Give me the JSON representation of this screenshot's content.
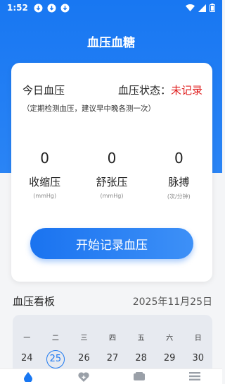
{
  "status_bar": {
    "time": "1:52"
  },
  "header": {
    "title": "血压血糖"
  },
  "card": {
    "today_label": "今日血压",
    "status_label": "血压状态：",
    "status_value": "未记录",
    "note": "（定期检测血压，建议早中晚各测一次）",
    "metrics": [
      {
        "value": "0",
        "label": "收缩压",
        "unit": "(mmHg)"
      },
      {
        "value": "0",
        "label": "舒张压",
        "unit": "(mmHg)"
      },
      {
        "value": "0",
        "label": "脉搏",
        "unit": "(次/分钟)"
      }
    ],
    "start_button": "开始记录血压"
  },
  "board": {
    "title": "血压看板",
    "date": "2025年11月25日",
    "weekdays": [
      "一",
      "二",
      "三",
      "四",
      "五",
      "六",
      "日"
    ],
    "days": [
      "24",
      "25",
      "26",
      "27",
      "28",
      "29",
      "30"
    ],
    "selected_index": 1
  },
  "colors": {
    "accent": "#1877f2",
    "status_red": "#e02020"
  },
  "tabbar": {
    "icons": [
      "blood-drop-icon",
      "heart-icon",
      "device-icon",
      "menu-icon"
    ]
  }
}
